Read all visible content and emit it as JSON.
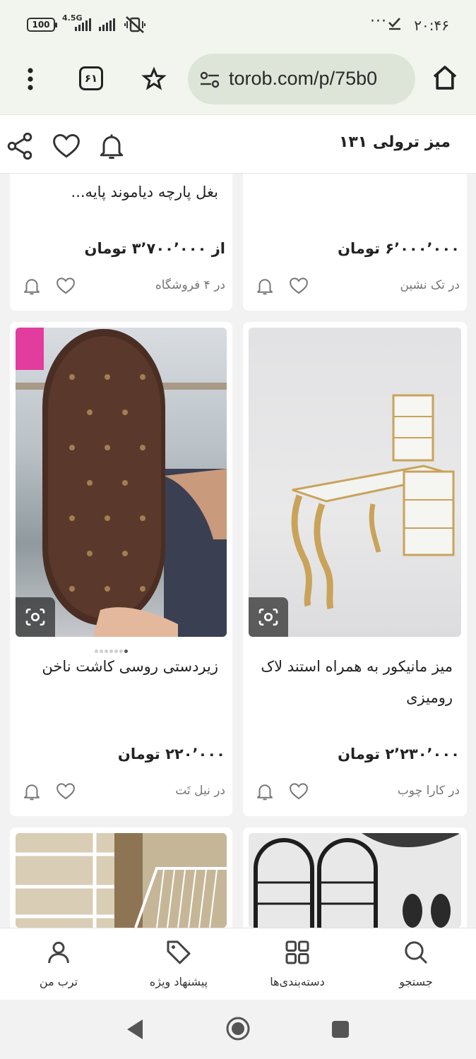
{
  "status_bar": {
    "time": "۲۰:۴۶",
    "battery": "100",
    "network": "4.5G",
    "overflow": "···"
  },
  "browser": {
    "url": "torob.com/p/75b0",
    "tab_count": "۶۱"
  },
  "page": {
    "title": "میز ترولی ۱۳۱"
  },
  "products": [
    {
      "title": "",
      "price": "۶٬۰۰۰٬۰۰۰ تومان",
      "shop": "در تک نشین"
    },
    {
      "title": "بغل پارچه دیاموند پایه...",
      "price": "از ۳٬۷۰۰٬۰۰۰ تومان",
      "shop": "در ۴ فروشگاه"
    },
    {
      "title": "میز مانیکور به همراه استند لاک رومیزی",
      "price": "۲٬۲۳۰٬۰۰۰ تومان",
      "shop": "در کارا چوب"
    },
    {
      "title": "زیردستی روسی کاشت ناخن",
      "price": "۲۲۰٬۰۰۰ تومان",
      "shop": "در نیل تَت"
    }
  ],
  "bottom_nav": [
    {
      "label": "جستجو",
      "icon": "search-icon"
    },
    {
      "label": "دسته‌بندی‌ها",
      "icon": "grid-icon"
    },
    {
      "label": "پیشنهاد ویژه",
      "icon": "tag-icon"
    },
    {
      "label": "ترب من",
      "icon": "person-icon"
    }
  ],
  "image_carousel": {
    "count": 7,
    "active_index": 6
  }
}
